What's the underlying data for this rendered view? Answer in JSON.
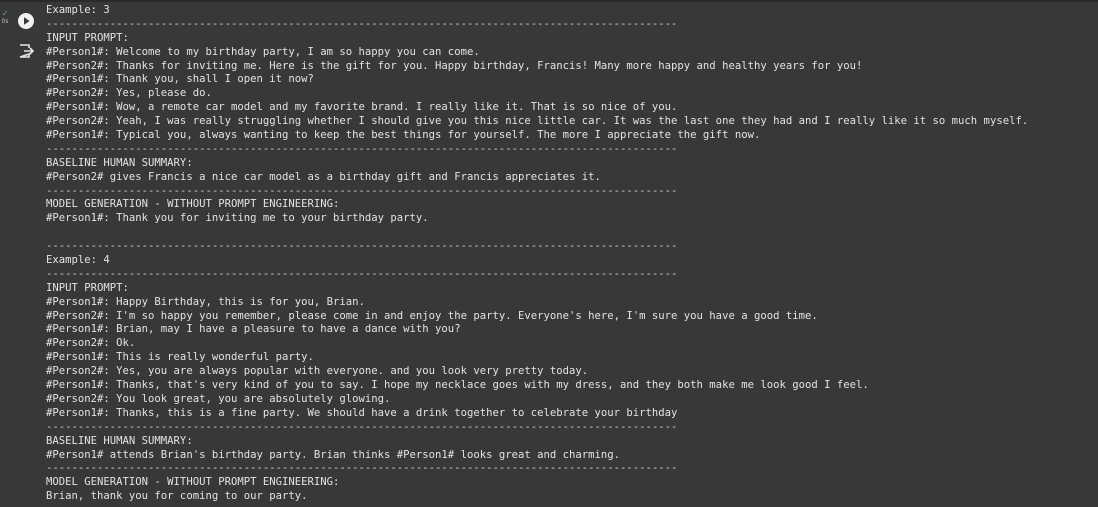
{
  "cell": {
    "status_icon": "check-icon",
    "exec_time": "0s",
    "run_icon": "play-circle-icon",
    "output_icon": "output-action-icon",
    "accent_color": "#5cb85c"
  },
  "output_lines": [
    "Example: 3",
    "---------------------------------------------------------------------------------------------------",
    "INPUT PROMPT:",
    "#Person1#: Welcome to my birthday party, I am so happy you can come.",
    "#Person2#: Thanks for inviting me. Here is the gift for you. Happy birthday, Francis! Many more happy and healthy years for you!",
    "#Person1#: Thank you, shall I open it now?",
    "#Person2#: Yes, please do.",
    "#Person1#: Wow, a remote car model and my favorite brand. I really like it. That is so nice of you.",
    "#Person2#: Yeah, I was really struggling whether I should give you this nice little car. It was the last one they had and I really like it so much myself.",
    "#Person1#: Typical you, always wanting to keep the best things for yourself. The more I appreciate the gift now.",
    "---------------------------------------------------------------------------------------------------",
    "BASELINE HUMAN SUMMARY:",
    "#Person2# gives Francis a nice car model as a birthday gift and Francis appreciates it.",
    "---------------------------------------------------------------------------------------------------",
    "MODEL GENERATION - WITHOUT PROMPT ENGINEERING:",
    "#Person1#: Thank you for inviting me to your birthday party.",
    "",
    "---------------------------------------------------------------------------------------------------",
    "Example: 4",
    "---------------------------------------------------------------------------------------------------",
    "INPUT PROMPT:",
    "#Person1#: Happy Birthday, this is for you, Brian.",
    "#Person2#: I'm so happy you remember, please come in and enjoy the party. Everyone's here, I'm sure you have a good time.",
    "#Person1#: Brian, may I have a pleasure to have a dance with you?",
    "#Person2#: Ok.",
    "#Person1#: This is really wonderful party.",
    "#Person2#: Yes, you are always popular with everyone. and you look very pretty today.",
    "#Person1#: Thanks, that's very kind of you to say. I hope my necklace goes with my dress, and they both make me look good I feel.",
    "#Person2#: You look great, you are absolutely glowing.",
    "#Person1#: Thanks, this is a fine party. We should have a drink together to celebrate your birthday",
    "---------------------------------------------------------------------------------------------------",
    "BASELINE HUMAN SUMMARY:",
    "#Person1# attends Brian's birthday party. Brian thinks #Person1# looks great and charming.",
    "---------------------------------------------------------------------------------------------------",
    "MODEL GENERATION - WITHOUT PROMPT ENGINEERING:",
    "Brian, thank you for coming to our party."
  ]
}
